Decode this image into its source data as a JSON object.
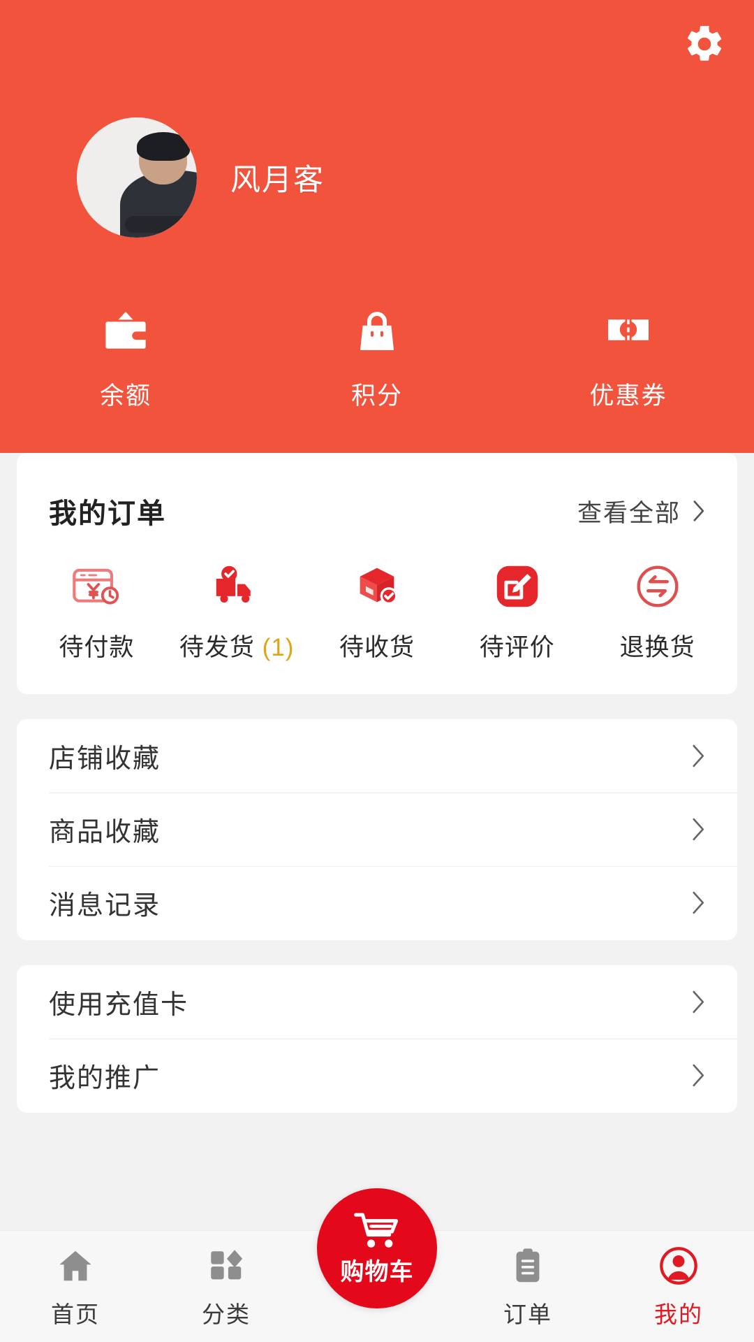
{
  "header": {
    "background_color": "#F2533C",
    "settings_icon": "gear-icon",
    "user": {
      "name": "风月客",
      "avatar_icon": "user-avatar-photo"
    },
    "stats": [
      {
        "icon": "wallet-icon",
        "label": "余额"
      },
      {
        "icon": "handbag-icon",
        "label": "积分"
      },
      {
        "icon": "ticket-icon",
        "label": "优惠券"
      }
    ]
  },
  "orders": {
    "title": "我的订单",
    "view_all_label": "查看全部",
    "view_all_icon": "chevron-right-icon",
    "items": [
      {
        "icon": "pending-payment-icon",
        "label": "待付款",
        "badge": ""
      },
      {
        "icon": "pending-shipment-icon",
        "label": "待发货",
        "badge": "(1)"
      },
      {
        "icon": "pending-receipt-icon",
        "label": "待收货",
        "badge": ""
      },
      {
        "icon": "pending-review-icon",
        "label": "待评价",
        "badge": ""
      },
      {
        "icon": "return-exchange-icon",
        "label": "退换货",
        "badge": ""
      }
    ]
  },
  "menu_group_1": {
    "items": [
      {
        "label": "店铺收藏",
        "chevron": "chevron-right-icon"
      },
      {
        "label": "商品收藏",
        "chevron": "chevron-right-icon"
      },
      {
        "label": "消息记录",
        "chevron": "chevron-right-icon"
      }
    ]
  },
  "menu_group_2": {
    "items": [
      {
        "label": "使用充值卡",
        "chevron": "chevron-right-icon"
      },
      {
        "label": "我的推广",
        "chevron": "chevron-right-icon"
      }
    ]
  },
  "tabbar": {
    "cart": {
      "label": "购物车",
      "icon": "shopping-cart-icon",
      "color": "#E4091A"
    },
    "tabs": [
      {
        "label": "首页",
        "icon": "home-icon",
        "active": false
      },
      {
        "label": "分类",
        "icon": "grid-icon",
        "active": false
      },
      {
        "label": "订单",
        "icon": "clipboard-icon",
        "active": false
      },
      {
        "label": "我的",
        "icon": "person-icon",
        "active": true
      }
    ],
    "active_color": "#E01A22",
    "inactive_color": "#8E8E8E"
  }
}
